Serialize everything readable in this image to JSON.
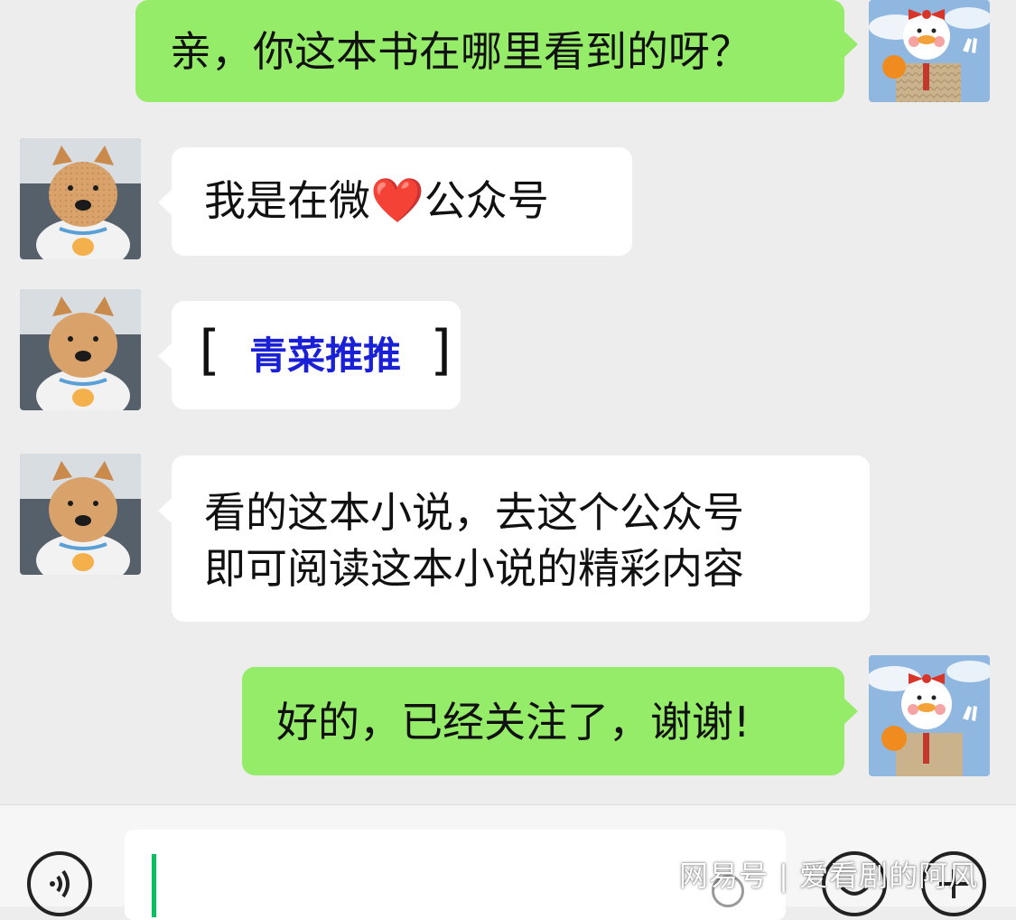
{
  "messages": [
    {
      "side": "out",
      "avatar": "duck-avatar",
      "text": "亲，你这本书在哪里看到的呀？"
    },
    {
      "side": "in",
      "avatar": "dog-avatar",
      "text_before": "我是在微",
      "emoji": "❤️",
      "emoji_name": "red-heart-emoji",
      "text_after": "公众号"
    },
    {
      "side": "in",
      "avatar": "dog-avatar",
      "bracket_open": "[",
      "link_text": "青菜推推",
      "bracket_close": "]",
      "link_color": "#1a20d6"
    },
    {
      "side": "in",
      "avatar": "dog-avatar",
      "line1": "看的这本小说，去这个公众号",
      "line2": "即可阅读这本小说的精彩内容"
    },
    {
      "side": "out",
      "avatar": "duck-avatar",
      "text": "好的，已经关注了，谢谢!"
    }
  ],
  "input_bar": {
    "voice_icon": "voice-icon",
    "emoji_icon": "emoji-icon",
    "plus_icon": "plus-icon",
    "input_value": ""
  },
  "watermark": "网易号 | 爱看剧的阿风",
  "colors": {
    "outgoing_bubble": "#95ec69",
    "incoming_bubble": "#ffffff",
    "background": "#ededed",
    "caret": "#07c160"
  }
}
